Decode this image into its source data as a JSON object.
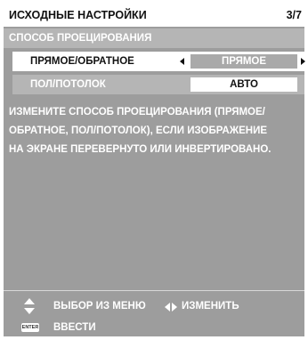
{
  "header": {
    "title": "ИСХОДНЫЕ НАСТРОЙКИ",
    "page": "3/7"
  },
  "section": {
    "title": "СПОСОБ ПРОЕЦИРОВАНИЯ"
  },
  "settings": [
    {
      "label": "ПРЯМОЕ/ОБРАТНОЕ",
      "value": "ПРЯМОЕ"
    },
    {
      "label": "ПОЛ/ПОТОЛОК",
      "value": "АВТО"
    }
  ],
  "message": [
    "ИЗМЕНИТЕ СПОСОБ ПРОЕЦИРОВАНИЯ (ПРЯМОЕ/",
    "ОБРАТНОЕ, ПОЛ/ПОТОЛОК), ЕСЛИ ИЗОБРАЖЕНИЕ",
    "НА ЭКРАНЕ ПЕРЕВЕРНУТО ИЛИ ИНВЕРТИРОВАНО."
  ],
  "footer": {
    "select_label": "ВЫБОР ИЗ МЕНЮ",
    "change_label": "ИЗМЕНИТЬ",
    "enter_key": "ENTER",
    "enter_label": "ВВЕСТИ"
  },
  "icons": {
    "select": "up-down-arrows-icon",
    "change": "left-right-arrows-icon",
    "enter": "enter-key-icon"
  },
  "colors": {
    "panel": "#9d9d9d",
    "row_inactive": "#b5b5b5",
    "selected_row": "#ffffff"
  }
}
